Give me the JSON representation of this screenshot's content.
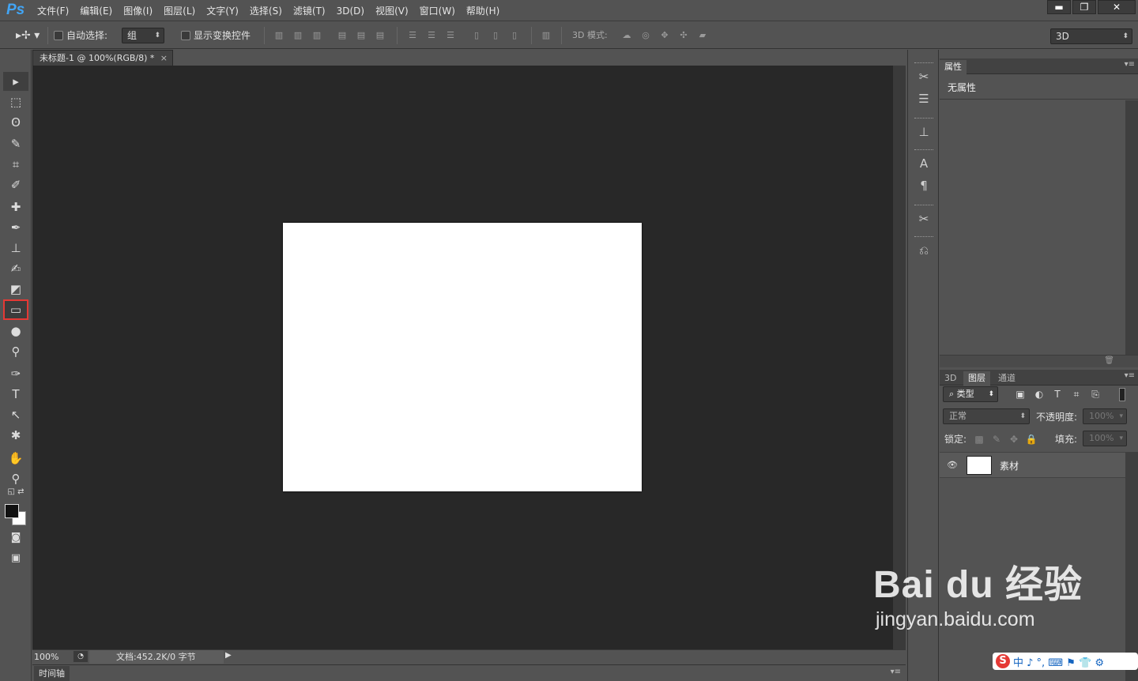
{
  "app": {
    "logo": "Ps"
  },
  "menu": [
    "文件(F)",
    "编辑(E)",
    "图像(I)",
    "图层(L)",
    "文字(Y)",
    "选择(S)",
    "滤镜(T)",
    "3D(D)",
    "视图(V)",
    "窗口(W)",
    "帮助(H)"
  ],
  "window_buttons": {
    "minimize": "▬",
    "restore": "❐",
    "close": "✕"
  },
  "options": {
    "auto_select_label": "自动选择:",
    "auto_select_value": "组",
    "show_transform_label": "显示变换控件",
    "mode_3d_label": "3D 模式:",
    "workspace_value": "3D"
  },
  "document": {
    "tab_title": "未标题-1 @ 100%(RGB/8) *",
    "tab_close": "×",
    "zoom": "100%",
    "doc_info": "文档:452.2K/0 字节",
    "canvas_color": "#ffffff"
  },
  "timeline": {
    "label": "时间轴"
  },
  "properties_panel": {
    "tab": "属性",
    "empty_text": "无属性"
  },
  "layers_panel": {
    "tabs": [
      "3D",
      "图层",
      "通道"
    ],
    "active_tab": "图层",
    "filter_kind": "类型",
    "blend_mode": "正常",
    "opacity_label": "不透明度:",
    "opacity_value": "100%",
    "lock_label": "锁定:",
    "fill_label": "填充:",
    "fill_value": "100%",
    "layers": [
      {
        "name": "素材",
        "visible": true
      }
    ]
  },
  "watermark": {
    "brand": "Bai du 经验",
    "url": "jingyan.baidu.com"
  },
  "ime": {
    "logo": "S",
    "text": "中 ♪ °, ⌨ ⚑ 👕 ⚙"
  }
}
